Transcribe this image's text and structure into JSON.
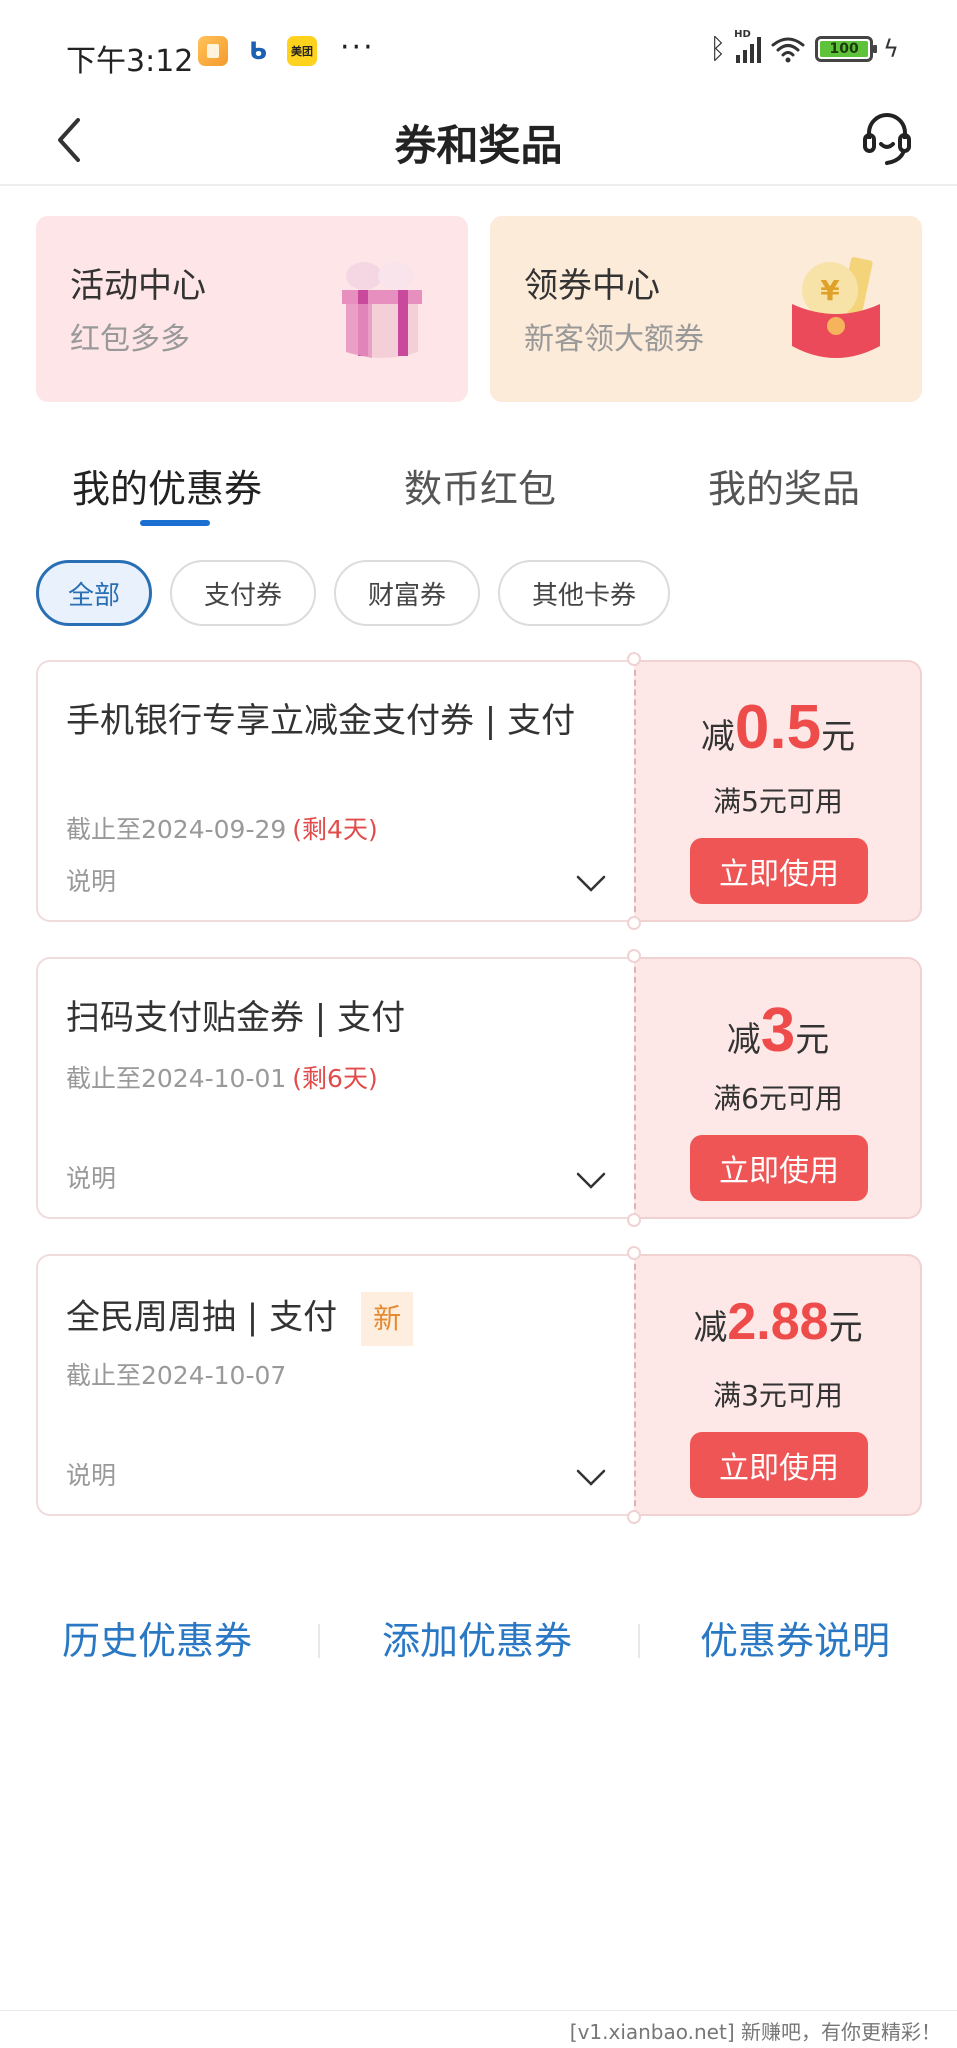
{
  "status_bar": {
    "time": "下午3:12",
    "apps": [
      "notes-app",
      "baidu-app",
      "美团"
    ],
    "more": "···",
    "battery": "100"
  },
  "header": {
    "title": "券和奖品",
    "back_icon": "chevron-left-icon",
    "service_icon": "headset-icon"
  },
  "entries": [
    {
      "title": "活动中心",
      "subtitle": "红包多多",
      "icon": "gift-box-icon",
      "bg": "#fde5e8"
    },
    {
      "title": "领券中心",
      "subtitle": "新客领大额券",
      "icon": "red-envelope-icon",
      "bg": "#fdebd9"
    }
  ],
  "tabs": [
    {
      "label": "我的优惠券",
      "active": true
    },
    {
      "label": "数币红包",
      "active": false
    },
    {
      "label": "我的奖品",
      "active": false
    }
  ],
  "filters": [
    {
      "label": "全部",
      "active": true
    },
    {
      "label": "支付券",
      "active": false
    },
    {
      "label": "财富券",
      "active": false
    },
    {
      "label": "其他卡券",
      "active": false
    }
  ],
  "coupons": [
    {
      "title": "手机银行专享立减金支付券 | 支付",
      "badge": null,
      "expire": "截止至2024-09-29",
      "remain": "(剩4天)",
      "desc": "说明",
      "prefix": "减",
      "amount": "0.5",
      "unit": "元",
      "condition": "满5元可用",
      "action": "立即使用"
    },
    {
      "title": "扫码支付贴金券 | 支付",
      "badge": null,
      "expire": "截止至2024-10-01",
      "remain": "(剩6天)",
      "desc": "说明",
      "prefix": "减",
      "amount": "3",
      "unit": "元",
      "condition": "满6元可用",
      "action": "立即使用"
    },
    {
      "title": "全民周周抽 | 支付",
      "badge": "新",
      "expire": "截止至2024-10-07",
      "remain": "",
      "desc": "说明",
      "prefix": "减",
      "amount": "2.88",
      "unit": "元",
      "condition": "满3元可用",
      "action": "立即使用"
    }
  ],
  "bottom_links": [
    "历史优惠券",
    "添加优惠券",
    "优惠券说明"
  ],
  "watermark": "[v1.xianbao.net] 新赚吧，有你更精彩！",
  "colors": {
    "accent_blue": "#1a6fd0",
    "link_blue": "#2a78c4",
    "amount_red": "#ee4b4b",
    "button_red": "#f05555",
    "coupon_right_bg": "#fde7e7"
  }
}
